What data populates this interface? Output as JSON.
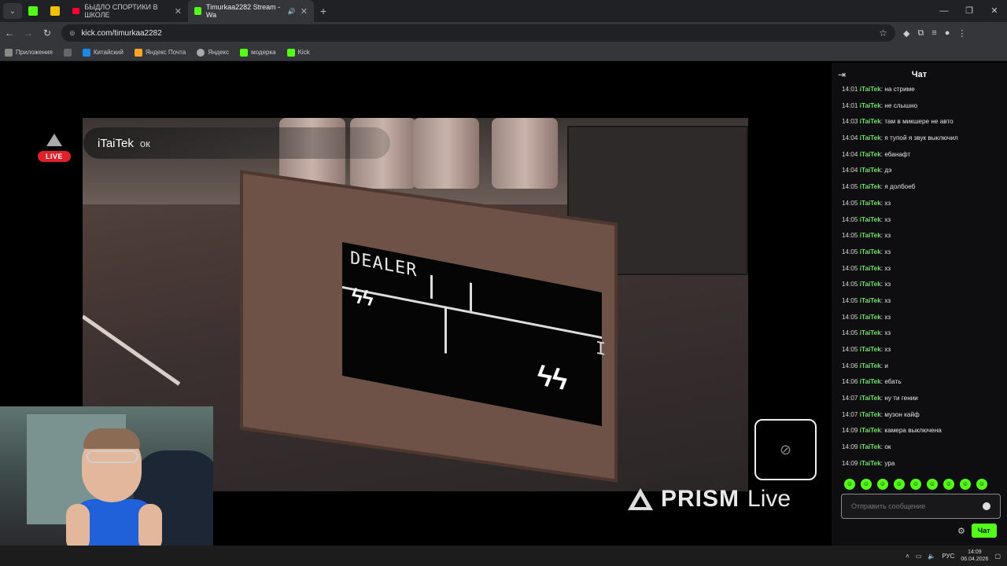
{
  "browser": {
    "tabs": [
      {
        "label": "БЫДЛО СПОРТИКИ В ШКОЛЕ",
        "active": false
      },
      {
        "label": "Timurkaa2282 Stream - Wa",
        "active": true
      }
    ],
    "address": "kick.com/timurkaa2282",
    "bookmarks": [
      "Приложения",
      "Китайский",
      "Яндекс Почта",
      "Яндекс",
      "модерка",
      "Kick"
    ]
  },
  "stream": {
    "live_badge": "LIVE",
    "alert": {
      "name": "iTaiTek",
      "message": "ок"
    },
    "game_panel": {
      "label": "DEALER",
      "left_charges": "ϟϟ",
      "right_charges": "ϟϟ",
      "marker": "I"
    },
    "watermark": {
      "brand": "PRISM",
      "suffix": "Live"
    },
    "camera_off_icon": "camera-off-icon"
  },
  "chat": {
    "title": "Чат",
    "messages": [
      {
        "time": "14:01",
        "user": "iTaiTek",
        "text": "на стриме"
      },
      {
        "time": "14:01",
        "user": "iTaiTek",
        "text": "не слышно"
      },
      {
        "time": "14:03",
        "user": "iTaiTek",
        "text": "там в микшере не авто"
      },
      {
        "time": "14:04",
        "user": "iTaiTek",
        "text": "я тупой я звук выключил"
      },
      {
        "time": "14:04",
        "user": "iTaiTek",
        "text": "ебанафт"
      },
      {
        "time": "14:04",
        "user": "iTaiTek",
        "text": "дэ"
      },
      {
        "time": "14:05",
        "user": "iTaiTek",
        "text": "я долбоеб"
      },
      {
        "time": "14:05",
        "user": "iTaiTek",
        "text": "хз"
      },
      {
        "time": "14:05",
        "user": "iTaiTek",
        "text": "хз"
      },
      {
        "time": "14:05",
        "user": "iTaiTek",
        "text": "хз"
      },
      {
        "time": "14:05",
        "user": "iTaiTek",
        "text": "хз"
      },
      {
        "time": "14:05",
        "user": "iTaiTek",
        "text": "хз"
      },
      {
        "time": "14:05",
        "user": "iTaiTek",
        "text": "хз"
      },
      {
        "time": "14:05",
        "user": "iTaiTek",
        "text": "хз"
      },
      {
        "time": "14:05",
        "user": "iTaiTek",
        "text": "хз"
      },
      {
        "time": "14:05",
        "user": "iTaiTek",
        "text": "хз"
      },
      {
        "time": "14:05",
        "user": "iTaiTek",
        "text": "хз"
      },
      {
        "time": "14:06",
        "user": "iTaiTek",
        "text": "и"
      },
      {
        "time": "14:06",
        "user": "iTaiTek",
        "text": "ебать"
      },
      {
        "time": "14:07",
        "user": "iTaiTek",
        "text": "ну ти гении"
      },
      {
        "time": "14:07",
        "user": "iTaiTek",
        "text": "музон кайф"
      },
      {
        "time": "14:09",
        "user": "iTaiTek",
        "text": "камера выключена"
      },
      {
        "time": "14:09",
        "user": "iTaiTek",
        "text": "ок"
      },
      {
        "time": "14:09",
        "user": "iTaiTek",
        "text": "ура"
      }
    ],
    "input_placeholder": "Отправить сообщение",
    "send_label": "Чат"
  },
  "taskbar": {
    "language": "РУС",
    "time": "14:09",
    "date": "06.04.2026"
  },
  "colors": {
    "kick_green": "#53fc18",
    "username_green": "#74e06c",
    "live_red": "#e0202a"
  }
}
